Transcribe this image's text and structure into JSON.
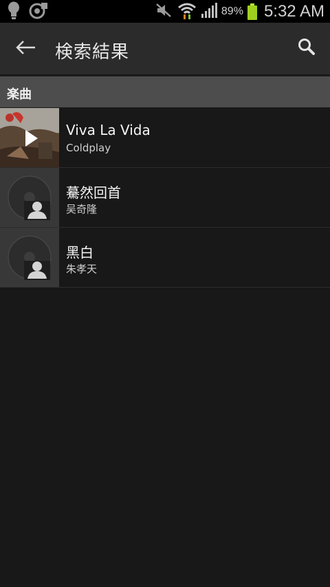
{
  "status_bar": {
    "battery_percent": "89%",
    "time": "5:32 AM",
    "icons": [
      "bulb-icon",
      "sync-icon",
      "mute-icon",
      "wifi-icon",
      "signal-icon",
      "battery-icon"
    ]
  },
  "app_bar": {
    "title": "検索結果",
    "back_icon": "back-arrow-icon",
    "search_icon": "search-icon"
  },
  "section": {
    "label": "楽曲"
  },
  "results": [
    {
      "title": "Viva La Vida",
      "artist": "Coldplay",
      "art": "album-art"
    },
    {
      "title": "驀然回首",
      "artist": "吴奇隆",
      "art": "placeholder-artist-icon"
    },
    {
      "title": "黑白",
      "artist": "朱孝天",
      "art": "placeholder-artist-icon"
    }
  ]
}
